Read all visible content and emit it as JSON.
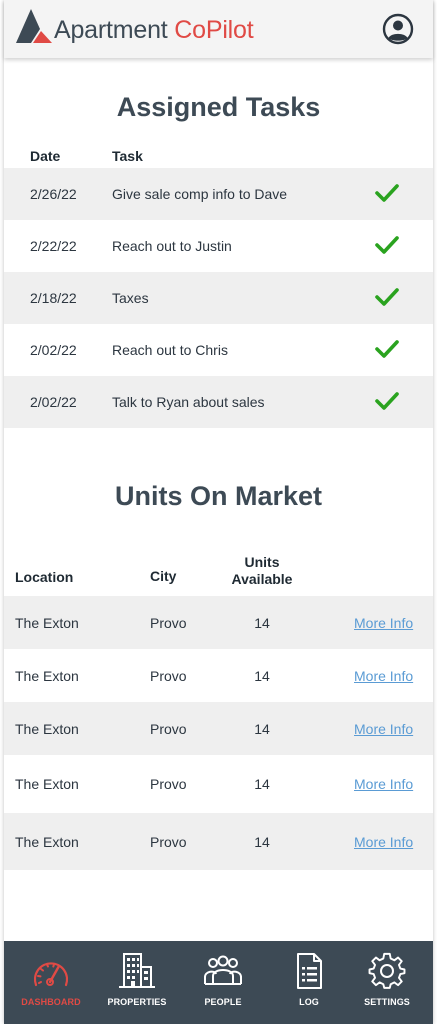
{
  "header": {
    "brand_main": "Apartment ",
    "brand_accent": "CoPilot"
  },
  "tasks": {
    "title": "Assigned Tasks",
    "col_date": "Date",
    "col_task": "Task",
    "rows": [
      {
        "date": "2/26/22",
        "task": "Give sale comp info to Dave",
        "done": true
      },
      {
        "date": "2/22/22",
        "task": "Reach out to Justin",
        "done": true
      },
      {
        "date": "2/18/22",
        "task": "Taxes",
        "done": true
      },
      {
        "date": "2/02/22",
        "task": "Reach out to Chris",
        "done": true
      },
      {
        "date": "2/02/22",
        "task": "Talk to Ryan about sales",
        "done": true
      }
    ]
  },
  "units": {
    "title": "Units On Market",
    "col_location": "Location",
    "col_city": "City",
    "col_units_line1": "Units",
    "col_units_line2": "Available",
    "rows": [
      {
        "location": "The Exton",
        "city": "Provo",
        "count": "14",
        "link": "More Info"
      },
      {
        "location": "The Exton",
        "city": "Provo",
        "count": "14",
        "link": "More Info"
      },
      {
        "location": "The Exton",
        "city": "Provo",
        "count": "14",
        "link": "More Info"
      },
      {
        "location": "The Exton",
        "city": "Provo",
        "count": "14",
        "link": "More Info"
      },
      {
        "location": "The Exton",
        "city": "Provo",
        "count": "14",
        "link": "More Info"
      }
    ]
  },
  "nav": {
    "items": [
      {
        "label": "DASHBOARD",
        "icon": "speedometer-icon",
        "active": true
      },
      {
        "label": "PROPERTIES",
        "icon": "building-icon",
        "active": false
      },
      {
        "label": "PEOPLE",
        "icon": "people-icon",
        "active": false
      },
      {
        "label": "LOG",
        "icon": "document-icon",
        "active": false
      },
      {
        "label": "SETTINGS",
        "icon": "gear-icon",
        "active": false
      }
    ]
  },
  "colors": {
    "accent": "#e04a45",
    "dark": "#3d4a55",
    "check": "#2aa31f",
    "link": "#5a9bd4"
  }
}
